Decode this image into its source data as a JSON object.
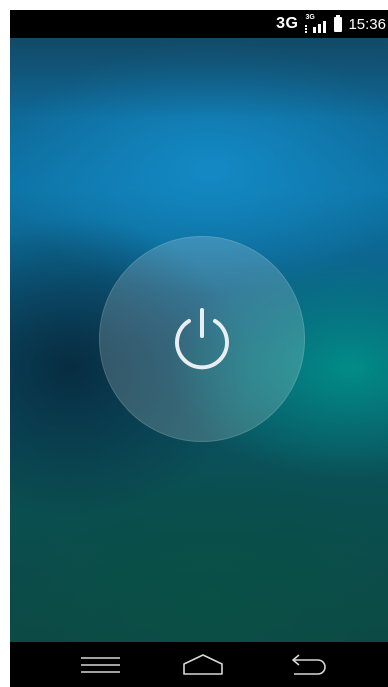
{
  "status_bar": {
    "network_type": "3G",
    "signal_label": "3G",
    "time": "15:36",
    "icons": [
      "signal-icon",
      "battery-icon"
    ]
  },
  "lock_screen": {
    "power_button_icon": "power-icon"
  },
  "nav_bar": {
    "buttons": [
      "menu-icon",
      "home-icon",
      "back-icon"
    ]
  }
}
